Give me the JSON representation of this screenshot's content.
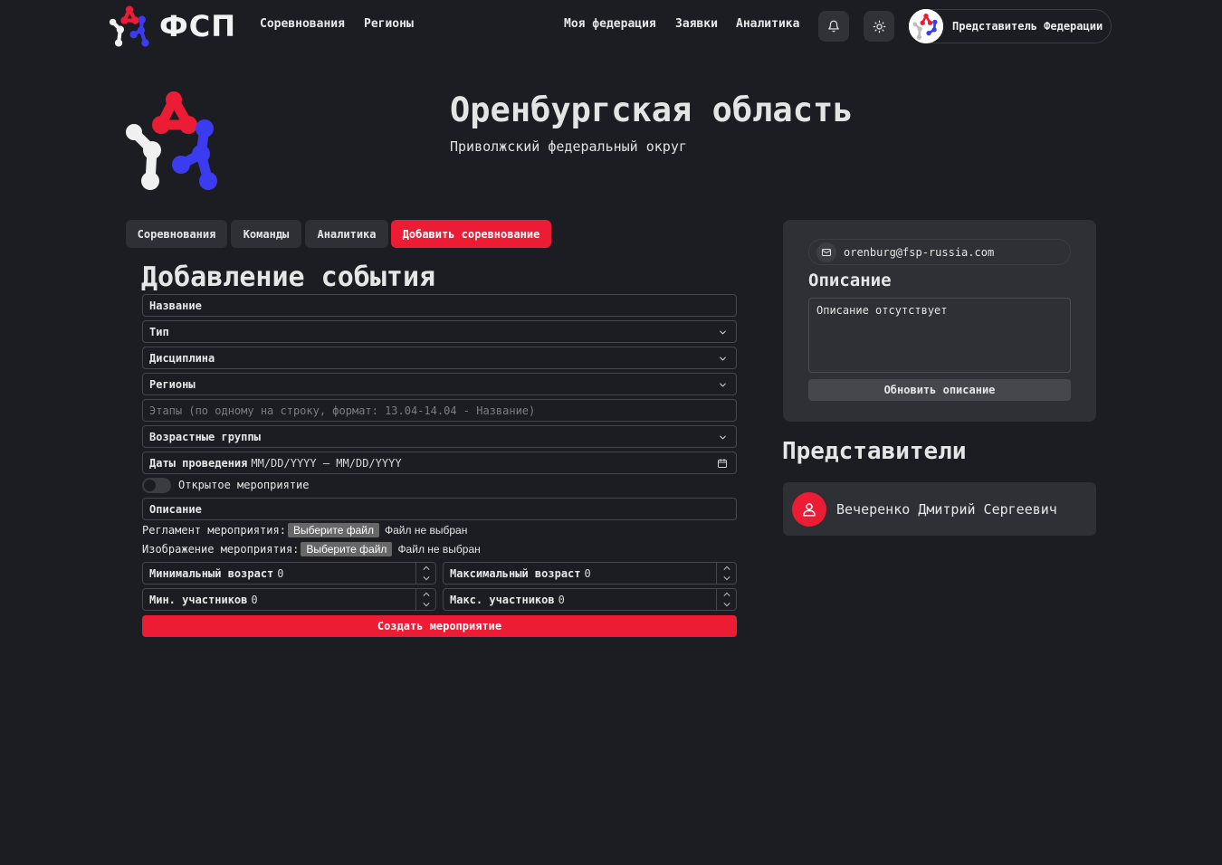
{
  "brand": {
    "name": "ФСП"
  },
  "header": {
    "nav_left": [
      "Соревнования",
      "Регионы"
    ],
    "nav_right": [
      "Моя федерация",
      "Заявки",
      "Аналитика"
    ],
    "profile_label": "Представитель Федерации"
  },
  "hero": {
    "title": "Оренбургская область",
    "subtitle": "Приволжский федеральный округ"
  },
  "tabs": [
    {
      "label": "Соревнования"
    },
    {
      "label": "Команды"
    },
    {
      "label": "Аналитика"
    },
    {
      "label": "Добавить соревнование",
      "active": true
    }
  ],
  "form": {
    "title": "Добавление события",
    "name_label": "Название",
    "type_label": "Тип",
    "discipline_label": "Дисциплина",
    "regions_label": "Регионы",
    "stages_placeholder": "Этапы (по одному на строку, формат: 13.04-14.04 - Название)",
    "age_groups_label": "Возрастные группы",
    "dates_label": "Даты проведения",
    "dates_value": "MM/DD/YYYY – MM/DD/YYYY",
    "open_event_label": "Открытое мероприятие",
    "description_label": "Описание",
    "rules_label": "Регламент мероприятия:",
    "image_label": "Изображение мероприятия:",
    "file_button": "Выберите файл",
    "file_none": "Файл не выбран",
    "min_age_label": "Минимальный возраст",
    "min_age_value": "0",
    "max_age_label": "Максимальный возраст",
    "max_age_value": "0",
    "min_participants_label": "Мин. участников",
    "min_participants_value": "0",
    "max_participants_label": "Макс. участников",
    "max_participants_value": "0",
    "submit_label": "Создать мероприятие"
  },
  "sidebar": {
    "email": "orenburg@fsp-russia.com",
    "description_heading": "Описание",
    "description_text": "Описание отсутствует",
    "update_button": "Обновить описание",
    "reps_heading": "Представители",
    "reps": [
      {
        "name": "Вечеренко Дмитрий Сергеевич"
      }
    ]
  },
  "colors": {
    "accent": "#ec1c34",
    "background": "#1c1d22",
    "card": "#2f3036",
    "logo_blue": "#3b3bf0"
  }
}
